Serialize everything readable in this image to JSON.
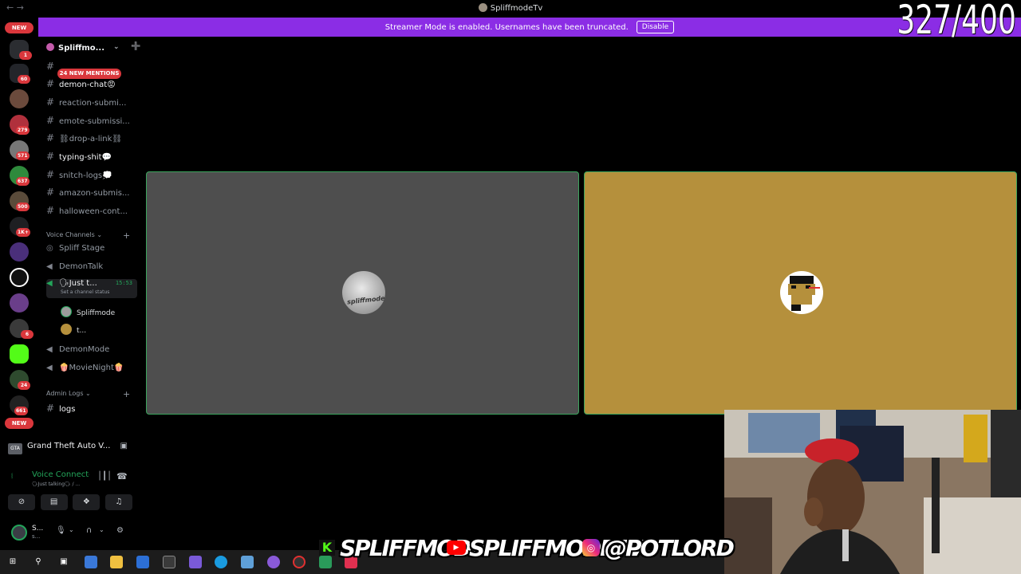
{
  "window": {
    "title": "SpliffmodeTv",
    "nav": "← →"
  },
  "banner": {
    "text": "Streamer Mode is enabled. Usernames have been truncated.",
    "button": "Disable"
  },
  "overlay": {
    "counter": "327/400"
  },
  "rail": {
    "new_top": "NEW",
    "new_bottom": "NEW",
    "badges": [
      "1",
      "60",
      "279",
      "571",
      "637",
      "500",
      "1K+",
      "6",
      "24",
      "661"
    ]
  },
  "server": {
    "name": "Spliffmo...",
    "chevron": "⌄",
    "invite_icon": "add-user-icon"
  },
  "mentions_pill": "24 NEW MENTIONS",
  "text_channels": [
    {
      "name": "demon-chat😡",
      "unread": true
    },
    {
      "name": "reaction-submi...",
      "unread": false
    },
    {
      "name": "emote-submissi...",
      "unread": false
    },
    {
      "name": "⛓drop-a-link⛓",
      "unread": false
    },
    {
      "name": "typing-shit💬",
      "unread": true
    },
    {
      "name": "snitch-logs💭",
      "unread": false
    },
    {
      "name": "amazon-submis...",
      "unread": false
    },
    {
      "name": "halloween-cont...",
      "unread": false
    }
  ],
  "voice_category": "Voice Channels",
  "voice_channels": [
    {
      "name": "Spliff Stage"
    },
    {
      "name": "DemonTalk"
    },
    {
      "name": "🗣Just t...",
      "timer": "15:53",
      "status": "Set a channel status",
      "active": true
    },
    {
      "name": "DemonMode"
    },
    {
      "name": "🍿MovieNight🍿"
    }
  ],
  "voice_users": [
    "Spliffmode",
    "t..."
  ],
  "admin_category": "Admin Logs",
  "admin_channels": [
    "logs"
  ],
  "activity": {
    "game": "Grand Theft Auto V...",
    "game_icon": "GTA"
  },
  "voice_connection": {
    "title": "Voice Connected",
    "subtitle": "🗣Just talking🗣 / ..."
  },
  "user": {
    "name": "S...",
    "sub": "s..."
  },
  "social": {
    "kick": "SPLIFFMODE",
    "youtube": "SPLIFFMODETV",
    "instagram": "@POTLORD"
  },
  "colors": {
    "banner": "#8b2de5",
    "speaking_border": "#3ba55d",
    "left_tile": "#4e4e4e",
    "right_tile": "#b5903c",
    "badge": "#da373c"
  }
}
